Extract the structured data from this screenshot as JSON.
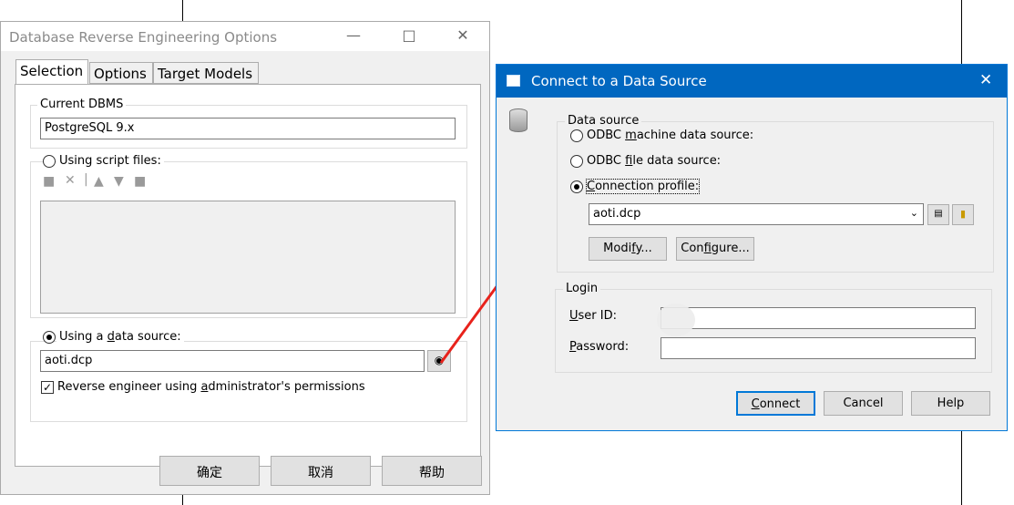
{
  "main_dialog": {
    "title": "Database Reverse Engineering Options",
    "tabs": [
      "Selection",
      "Options",
      "Target Models"
    ],
    "current_dbms": {
      "label": "Current DBMS",
      "value": "PostgreSQL 9.x"
    },
    "script_files": {
      "label": "Using script files:",
      "selected": false
    },
    "data_source": {
      "label": "Using a data source:",
      "selected": true,
      "value": "aoti.dcp"
    },
    "admin_permissions": {
      "label": "Reverse engineer using administrator's permissions",
      "checked": true
    },
    "buttons": {
      "ok": "确定",
      "cancel": "取消",
      "help": "帮助"
    }
  },
  "connect_dialog": {
    "title": "Connect to a Data Source",
    "data_source_group": "Data source",
    "options": [
      {
        "label": "ODBC machine data source:",
        "selected": false
      },
      {
        "label": "ODBC file data source:",
        "selected": false
      },
      {
        "label": "Connection profile:",
        "selected": true
      }
    ],
    "profile_value": "aoti.dcp",
    "modify_label": "Modify...",
    "configure_label": "Configure...",
    "login_group": "Login",
    "user_id_label": "User ID:",
    "user_id_value": "",
    "password_label": "Password:",
    "password_value": "",
    "buttons": {
      "connect": "Connect",
      "cancel": "Cancel",
      "help": "Help"
    }
  },
  "colors": {
    "title_blue": "#0067c0",
    "arrow_red": "#e8221b"
  }
}
